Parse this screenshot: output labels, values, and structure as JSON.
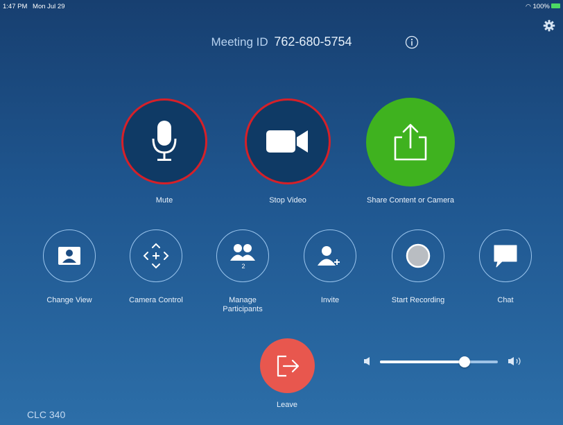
{
  "status_bar": {
    "time": "1:47 PM",
    "date": "Mon Jul 29",
    "battery": "100%"
  },
  "meeting": {
    "label": "Meeting ID",
    "id": "762-680-5754"
  },
  "main_actions": [
    {
      "label": "Mute",
      "icon": "microphone-icon"
    },
    {
      "label": "Stop Video",
      "icon": "video-camera-icon"
    },
    {
      "label": "Share Content or Camera",
      "icon": "share-icon"
    }
  ],
  "controls": [
    {
      "label": "Change View",
      "icon": "person-frame-icon"
    },
    {
      "label": "Camera Control",
      "icon": "camera-move-icon"
    },
    {
      "label": "Manage\nParticipants",
      "icon": "participants-icon",
      "count": "2"
    },
    {
      "label": "Invite",
      "icon": "add-person-icon"
    },
    {
      "label": "Start Recording",
      "icon": "record-icon"
    },
    {
      "label": "Chat",
      "icon": "chat-bubble-icon"
    }
  ],
  "leave": {
    "label": "Leave",
    "icon": "exit-icon"
  },
  "volume": {
    "level": 0.72
  },
  "room": "CLC 340",
  "colors": {
    "mute_ring": "#d62028",
    "share": "#3fb21f",
    "leave": "#e8574e"
  }
}
